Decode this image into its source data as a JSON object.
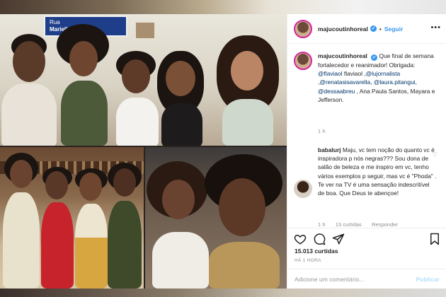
{
  "post": {
    "username": "majucoutinhoreal",
    "follow_label": "Seguir",
    "separator": "•",
    "sign_text_line1": "Rua",
    "sign_text_line2": "Marielle Franco"
  },
  "caption": {
    "username": "majucoutinhoreal",
    "text_1": "Que final de semana fortalecedor e reanimador! Obrigada: ",
    "mention_1": "@flaviaol",
    "text_2": " flaviaol ",
    "mention_2": ",@lujornalista",
    "text_3": " ,",
    "mention_3": "@renatasisavarella",
    "text_4": ", ",
    "mention_4": "@laura.pitangui",
    "text_5": ", ",
    "mention_5": "@dessaabreu",
    "text_6": " , Ana Paula Santos, Mayara e Jefferson.",
    "time": "1 h"
  },
  "comment": {
    "username": "babalurj",
    "text": " Maju, vc tem noção do quanto vc é inspiradora p nós negras??? Sou dona de salão de beleza e me inspiro em vc, tenho vários exemplos p seguir, mas vc é \"Phoda\" . Te ver na TV é uma sensação indescritível de boa. Que Deus te abençoe!",
    "time": "1 h",
    "likes": "13 curtidas",
    "reply_label": "Responder"
  },
  "stats": {
    "likes": "15.013 curtidas",
    "time_ago": "HÁ 1 HORA"
  },
  "add_comment": {
    "placeholder": "Adicione um comentário...",
    "publish_label": "Publicar"
  },
  "icons": {
    "like": "heart-icon",
    "comment": "speech-bubble-icon",
    "share": "paper-plane-icon",
    "save": "bookmark-icon",
    "more": "more-options-icon",
    "verified": "verified-badge-icon"
  },
  "colors": {
    "link_blue": "#3897f0",
    "mention_blue": "#003569",
    "muted": "#8e8e8e",
    "avatar_ring": "#d6249f"
  }
}
